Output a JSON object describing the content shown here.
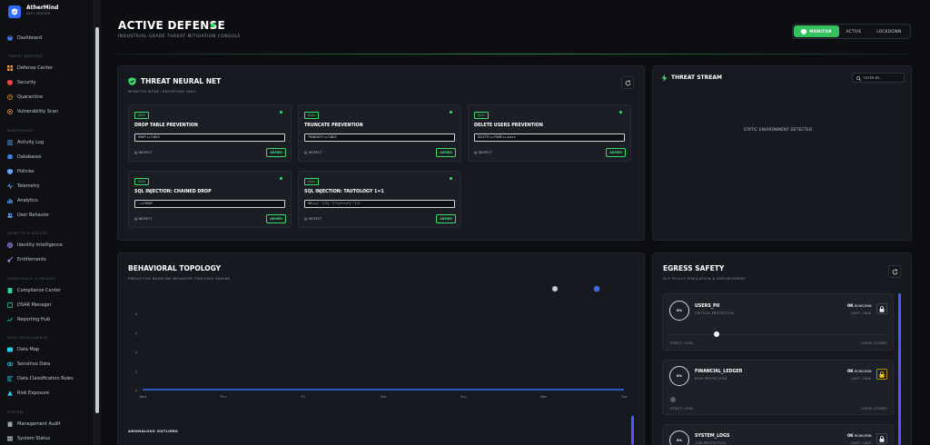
{
  "brand": {
    "name": "AtherMind",
    "subtitle": "DEFI LEDGER"
  },
  "sidebar": {
    "dashboard": "Dashboard",
    "groups": [
      {
        "title": "THREAT DEFENSE",
        "items": [
          "Defense Center",
          "Security",
          "Quarantine",
          "Vulnerability Scan"
        ]
      },
      {
        "title": "MONITORING",
        "items": [
          "Activity Log",
          "Databases",
          "Policies",
          "Telemetry",
          "Analytics",
          "User Behavior"
        ]
      },
      {
        "title": "IDENTITY & ACCESS",
        "items": [
          "Identity Intelligence",
          "Entitlements"
        ]
      },
      {
        "title": "COMPLIANCE & PRIVACY",
        "items": [
          "Compliance Center",
          "DSAR Manager",
          "Reporting Hub"
        ]
      },
      {
        "title": "DATA INTELLIGENCE",
        "items": [
          "Data Map",
          "Sensitive Data",
          "Data Classification Rules",
          "Risk Exposure"
        ]
      },
      {
        "title": "SYSTEM",
        "items": [
          "Management Audit",
          "System Status"
        ]
      }
    ]
  },
  "header": {
    "title": "ACTIVE DEFENSE",
    "subtitle": "INDUSTRIAL-GRADE THREAT MITIGATION CONSOLE",
    "modes": [
      "MONITOR",
      "ACTIVE",
      "LOCKDOWN"
    ],
    "active_mode": "MONITOR"
  },
  "neural": {
    "title": "THREAT NEURAL NET",
    "subtitle": "MONITOR MODE: REPORTING ONLY",
    "rules": [
      {
        "tag": "SQLI",
        "name": "DROP TABLE PREVENTION",
        "pattern": "DROP\\s+TABLE",
        "inspect": "INSPECT",
        "status": "ARMED"
      },
      {
        "tag": "SQLI",
        "name": "TRUNCATE PREVENTION",
        "pattern": "TRUNCATE\\s+TABLE",
        "inspect": "INSPECT",
        "status": "ARMED"
      },
      {
        "tag": "SQLI",
        "name": "DELETE USERS PREVENTION",
        "pattern": "DELETE\\s+FROM\\s+users",
        "inspect": "INSPECT",
        "status": "ARMED"
      },
      {
        "tag": "SQLI",
        "name": "SQL INJECTION: CHAINED DROP",
        "pattern": ";\\s*DROP",
        "inspect": "INSPECT",
        "status": "ARMED"
      },
      {
        "tag": "SQLI",
        "name": "SQL INJECTION: TAUTOLOGY 1=1",
        "pattern": "OR\\s+['\"]?1['\"]?\\s*=\\s*['\"]?1",
        "inspect": "INSPECT",
        "status": "ARMED"
      }
    ]
  },
  "stream": {
    "title": "THREAT STREAM",
    "filter_placeholder": "FILTER BY...",
    "empty": "STATIC ENVIRONMENT DETECTED"
  },
  "topology": {
    "title": "BEHAVIORAL TOPOLOGY",
    "subtitle": "PREDICTIVE BASELINE BEHAVIOR TRACKING ENGINE",
    "outliers_label": "ANOMALOUS OUTLIERS",
    "legend_colors": [
      "#cfd3d9",
      "#2f6bff"
    ]
  },
  "chart_data": {
    "type": "line",
    "x": [
      "Wed",
      "Thu",
      "Fri",
      "Sat",
      "Sun",
      "Mon",
      "Tue"
    ],
    "yticks": [
      "0",
      "0",
      "0",
      "0",
      "0"
    ],
    "series": [
      {
        "values": [
          0,
          0,
          0,
          0,
          0,
          0,
          0
        ],
        "color": "#2f6bff"
      }
    ],
    "grid": false
  },
  "egress": {
    "title": "EGRESS SAFETY",
    "subtitle": "DLP POLICY SIMULATION & ENFORCEMENT",
    "items": [
      {
        "pct": "0%",
        "name": "USERS_PII",
        "protection": "CRITICAL PROTECTION",
        "bw_value": "0K",
        "bw_unit": "ROWS/MIN",
        "limit": "LIMIT: 500K",
        "left": "STRICT (10M)",
        "right": "LOOSE (1000M)"
      },
      {
        "pct": "0%",
        "name": "FINANCIAL_LEDGER",
        "protection": "HIGH PROTECTION",
        "bw_value": "0K",
        "bw_unit": "ROWS/MIN",
        "limit": "LIMIT: 100K",
        "left": "STRICT (10M)",
        "right": "LOOSE (1000M)"
      },
      {
        "pct": "0%",
        "name": "SYSTEM_LOGS",
        "protection": "LOW PROTECTION",
        "bw_value": "0K",
        "bw_unit": "ROWS/MIN",
        "limit": "LIMIT: 100K"
      }
    ]
  }
}
